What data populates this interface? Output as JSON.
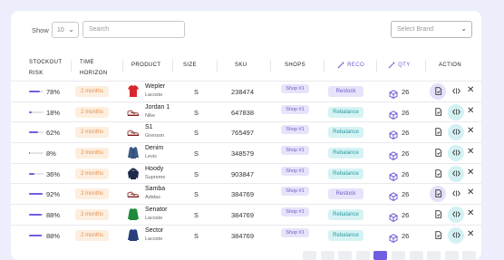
{
  "controls": {
    "show_label": "Show",
    "page_size": "10",
    "search_placeholder": "Search",
    "brand_placeholder": "Select Brand"
  },
  "headers": {
    "stockout_risk_1": "STOCKOUT",
    "stockout_risk_2": "RISK",
    "time_horizon_1": "TIME",
    "time_horizon_2": "HORIZON",
    "product": "PRODUCT",
    "size": "SIZE",
    "sku": "SKU",
    "shops": "SHOPS",
    "reco": "RECO",
    "qty": "QTY",
    "action": "ACTION"
  },
  "colors": {
    "accent": "#6d5fe0",
    "restock_bg": "#e7e3fb",
    "rebalance_bg": "#d6f3f4",
    "horizon_bg": "#fdeede"
  },
  "rows": [
    {
      "risk": "78%",
      "risk_value": 0.78,
      "horizon": "2 months",
      "product": "Wepler",
      "brand": "Lacoste",
      "thumb": "red-tshirt",
      "size": "S",
      "sku": "238474",
      "shop": "Shop #1",
      "reco": "Restock",
      "qty": "26",
      "doc_hl": true,
      "code_hl": false
    },
    {
      "risk": "18%",
      "risk_value": 0.18,
      "horizon": "2 months",
      "product": "Jordan 1",
      "brand": "Nike",
      "thumb": "sneaker",
      "size": "S",
      "sku": "647838",
      "shop": "Shop #1",
      "reco": "Rebalance",
      "qty": "26",
      "doc_hl": false,
      "code_hl": true
    },
    {
      "risk": "62%",
      "risk_value": 0.62,
      "horizon": "2 months",
      "product": "S1",
      "brand": "Grenson",
      "thumb": "sneaker",
      "size": "S",
      "sku": "765497",
      "shop": "Shop #1",
      "reco": "Rebalance",
      "qty": "26",
      "doc_hl": false,
      "code_hl": true
    },
    {
      "risk": "8%",
      "risk_value": 0.08,
      "horizon": "2 months",
      "product": "Denim",
      "brand": "Levis",
      "thumb": "denim-jacket",
      "size": "S",
      "sku": "348579",
      "shop": "Shop #1",
      "reco": "Rebalance",
      "qty": "26",
      "doc_hl": false,
      "code_hl": true
    },
    {
      "risk": "36%",
      "risk_value": 0.36,
      "horizon": "2 months",
      "product": "Hoody",
      "brand": "Supreme",
      "thumb": "hoodie",
      "size": "S",
      "sku": "903847",
      "shop": "Shop #1",
      "reco": "Rebalance",
      "qty": "26",
      "doc_hl": false,
      "code_hl": true
    },
    {
      "risk": "92%",
      "risk_value": 0.92,
      "horizon": "2 months",
      "product": "Samba",
      "brand": "Adidas",
      "thumb": "sneaker",
      "size": "S",
      "sku": "384769",
      "shop": "Shop #1",
      "reco": "Restock",
      "qty": "26",
      "doc_hl": true,
      "code_hl": false
    },
    {
      "risk": "88%",
      "risk_value": 0.88,
      "horizon": "2 months",
      "product": "Senator",
      "brand": "Lacoste",
      "thumb": "green-sweater",
      "size": "S",
      "sku": "384769",
      "shop": "Shop #1",
      "reco": "Rebalance",
      "qty": "26",
      "doc_hl": false,
      "code_hl": true
    },
    {
      "risk": "88%",
      "risk_value": 0.88,
      "horizon": "2 months",
      "product": "Sector",
      "brand": "Lacoste",
      "thumb": "blue-sweater",
      "size": "S",
      "sku": "384769",
      "shop": "Shop #1",
      "reco": "Rebalance",
      "qty": "26",
      "doc_hl": false,
      "code_hl": true
    }
  ],
  "pager": {
    "pages": 10,
    "active_index": 4
  }
}
